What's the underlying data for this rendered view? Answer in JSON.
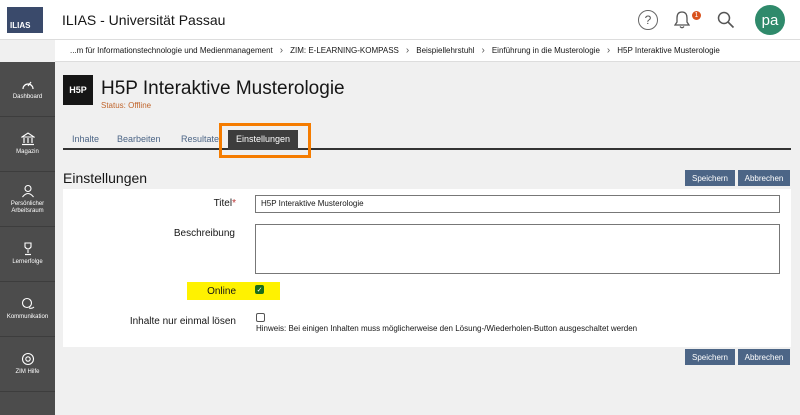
{
  "header": {
    "logo_text": "ILIAS",
    "app_title": "ILIAS - Universität Passau",
    "avatar_initials": "pa",
    "notification_count": "1"
  },
  "breadcrumb": [
    "...m für Informationstechnologie und Medienmanagement",
    "ZIM: E-LEARNING-KOMPASS",
    "Beispiellehrstuhl",
    "Einführung in die Musterologie",
    "H5P Interaktive Musterologie"
  ],
  "sidebar": {
    "items": [
      {
        "label": "Dashboard",
        "icon": "dashboard-icon"
      },
      {
        "label": "Magazin",
        "icon": "bank-icon"
      },
      {
        "label": "Persönlicher Arbeitsraum",
        "icon": "user-icon"
      },
      {
        "label": "Lernerfolge",
        "icon": "trophy-icon"
      },
      {
        "label": "Kommunikation",
        "icon": "chat-icon"
      },
      {
        "label": "ZIM Hilfe",
        "icon": "help-icon"
      }
    ]
  },
  "object": {
    "icon_text": "H5P",
    "title": "H5P Interaktive Musterologie",
    "status": "Status: Offline"
  },
  "tabs": [
    "Inhalte",
    "Bearbeiten",
    "Resultate",
    "Einstellungen"
  ],
  "settings": {
    "section_title": "Einstellungen",
    "save_label": "Speichern",
    "cancel_label": "Abbrechen",
    "title_label": "Titel",
    "title_required": "*",
    "title_value": "H5P Interaktive Musterologie",
    "description_label": "Beschreibung",
    "description_value": "",
    "online_label": "Online",
    "online_checked": true,
    "once_label": "Inhalte nur einmal lösen",
    "once_checked": false,
    "once_hint": "Hinweis: Bei einigen Inhalten muss möglicherweise den Lösung-/Wiederholen-Button ausgeschaltet werden"
  },
  "colors": {
    "highlight_tab_border": "#f57c00",
    "highlight_online": "#fff200",
    "button": "#4c6586",
    "sidebar": "#4c4c4c"
  }
}
